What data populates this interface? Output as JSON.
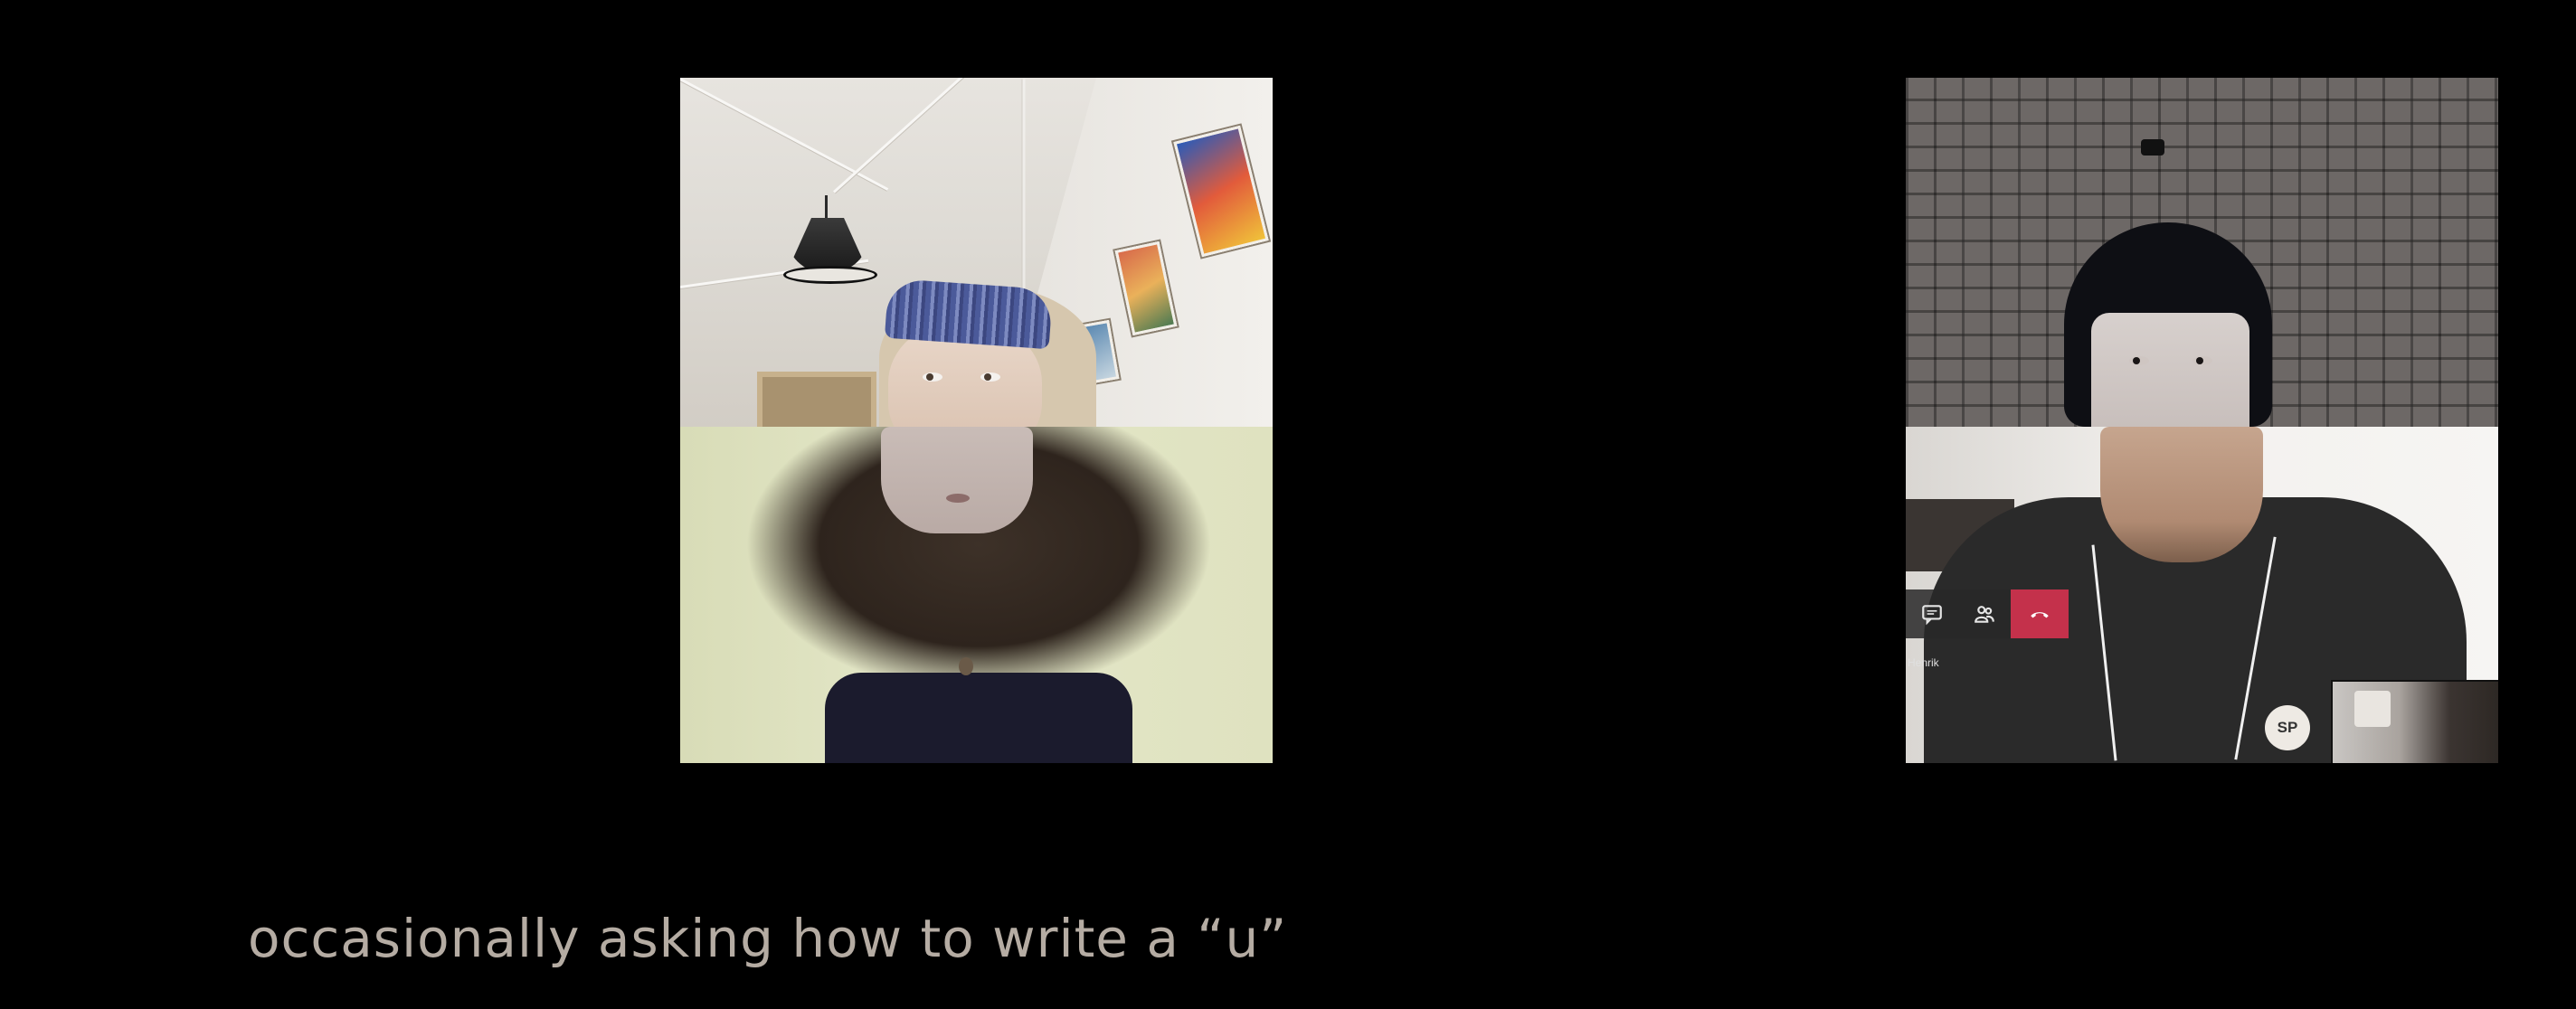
{
  "caption": {
    "text": "occasionally asking how to write a “u”"
  },
  "left_video": {
    "label": ""
  },
  "right_video": {
    "controls": {
      "chat_icon": "chat-icon",
      "participants_icon": "participants-icon",
      "hangup_icon": "phone-hangup-icon"
    },
    "caller_name": "Henrik",
    "avatar_initials": "SP"
  },
  "colors": {
    "background": "#000000",
    "caption": "#b5aca3",
    "hangup": "#c4314b"
  }
}
